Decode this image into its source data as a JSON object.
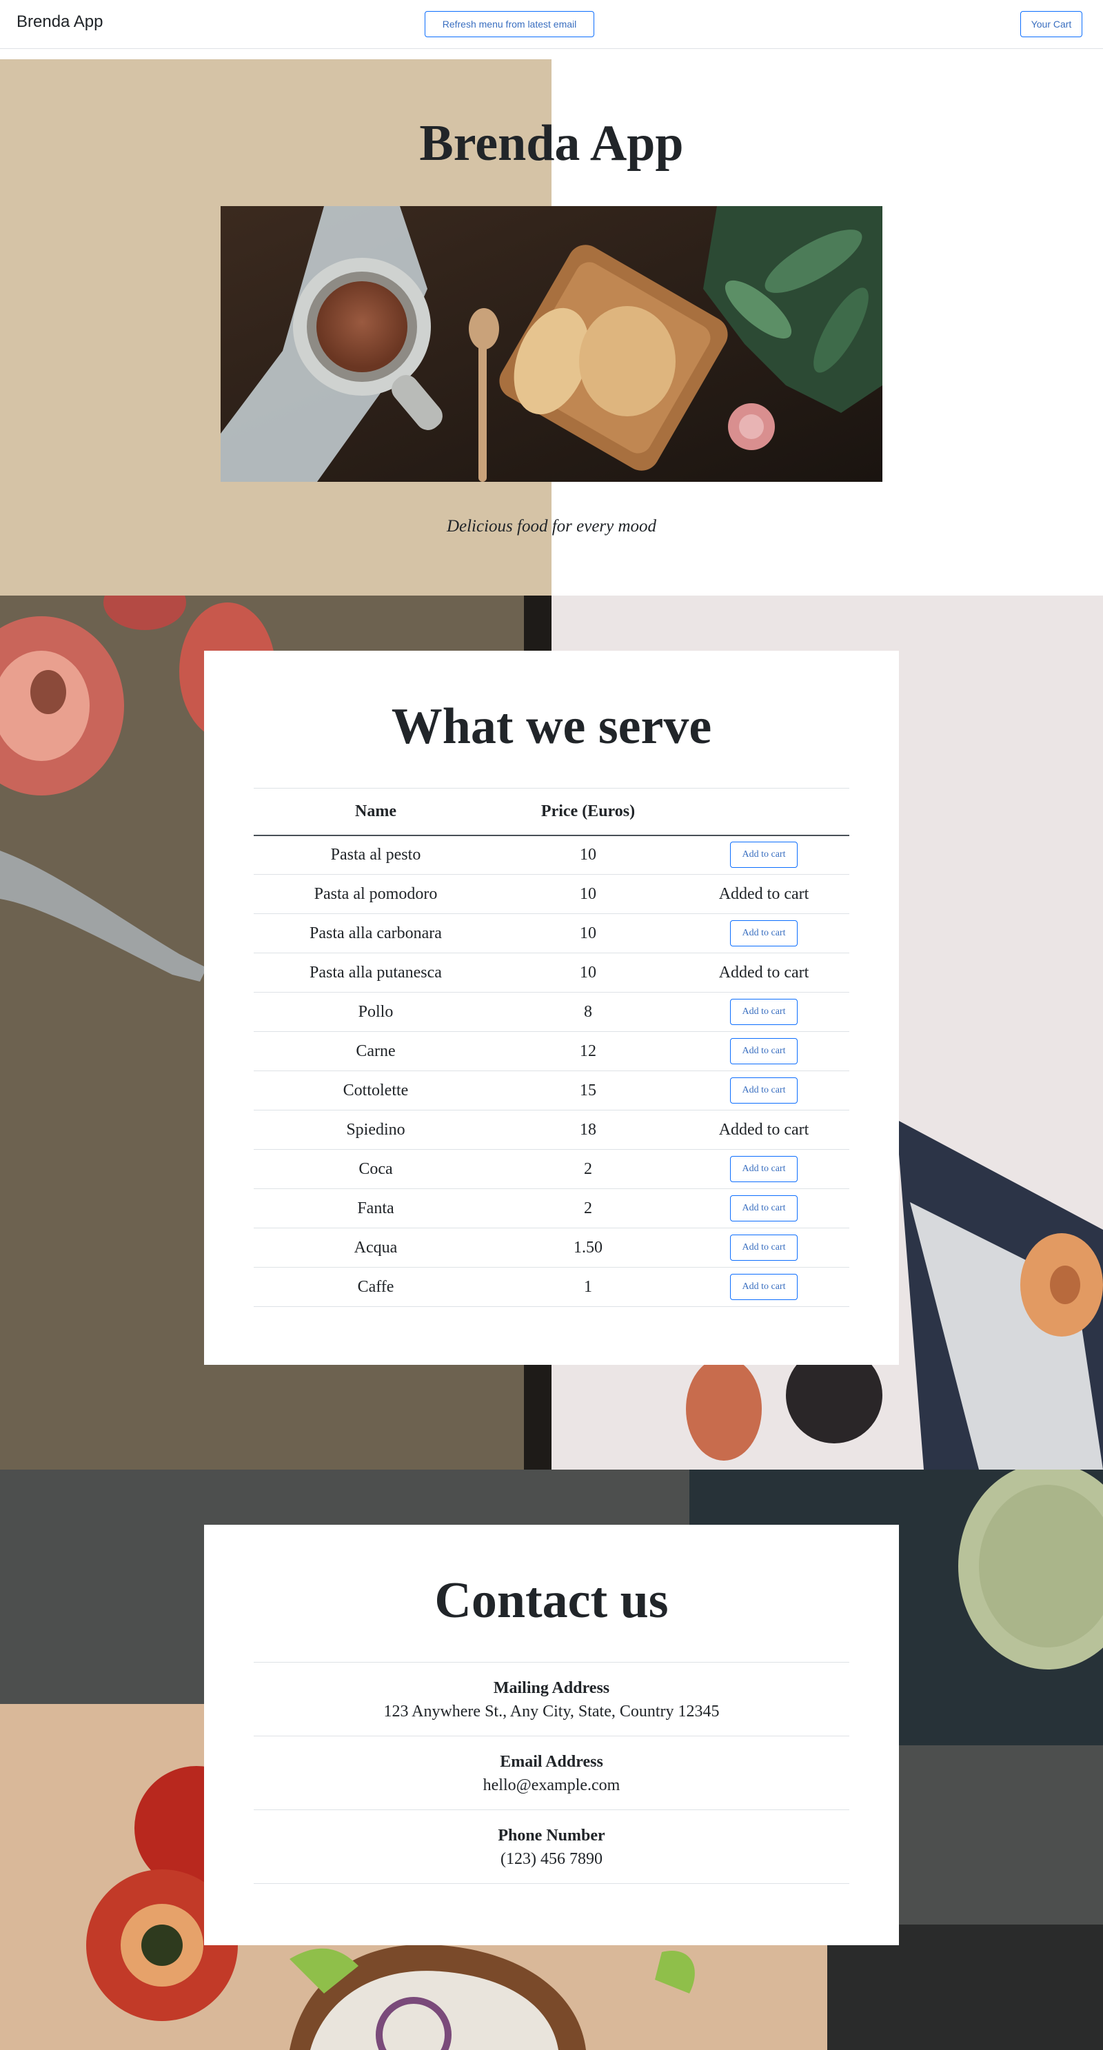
{
  "navbar": {
    "brand": "Brenda App",
    "refresh_label": "Refresh menu from latest email",
    "cart_label": "Your Cart"
  },
  "hero": {
    "title": "Brenda App",
    "tagline": "Delicious food for every mood"
  },
  "menu": {
    "title": "What we serve",
    "columns": [
      "Name",
      "Price (Euros)",
      ""
    ],
    "add_label": "Add to cart",
    "added_label": "Added to cart",
    "items": [
      {
        "name": "Pasta al pesto",
        "price": "10",
        "added": false
      },
      {
        "name": "Pasta al pomodoro",
        "price": "10",
        "added": true
      },
      {
        "name": "Pasta alla carbonara",
        "price": "10",
        "added": false
      },
      {
        "name": "Pasta alla putanesca",
        "price": "10",
        "added": true
      },
      {
        "name": "Pollo",
        "price": "8",
        "added": false
      },
      {
        "name": "Carne",
        "price": "12",
        "added": false
      },
      {
        "name": "Cottolette",
        "price": "15",
        "added": false
      },
      {
        "name": "Spiedino",
        "price": "18",
        "added": true
      },
      {
        "name": "Coca",
        "price": "2",
        "added": false
      },
      {
        "name": "Fanta",
        "price": "2",
        "added": false
      },
      {
        "name": "Acqua",
        "price": "1.50",
        "added": false
      },
      {
        "name": "Caffe",
        "price": "1",
        "added": false
      }
    ]
  },
  "contact": {
    "title": "Contact us",
    "entries": [
      {
        "label": "Mailing Address",
        "value": "123 Anywhere St., Any City, State, Country 12345"
      },
      {
        "label": "Email Address",
        "value": "hello@example.com"
      },
      {
        "label": "Phone Number",
        "value": "(123) 456 7890"
      }
    ]
  },
  "colors": {
    "accent": "#0d6efd",
    "hero_tan": "#d5c3a6",
    "text": "#212529"
  }
}
